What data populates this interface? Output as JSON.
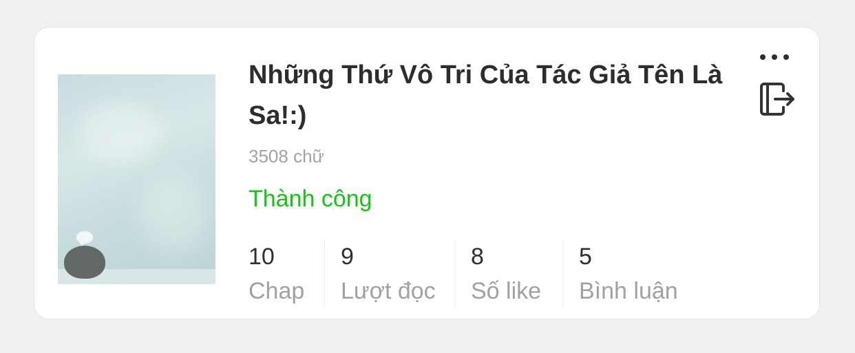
{
  "story": {
    "title": "Những Thứ Vô Tri Của Tác Giả Tên Là Sa!:)",
    "word_count": "3508 chữ",
    "status": "Thành công",
    "stats": [
      {
        "value": "10",
        "label": "Chap"
      },
      {
        "value": "9",
        "label": "Lượt đọc"
      },
      {
        "value": "8",
        "label": "Số like"
      },
      {
        "value": "5",
        "label": "Bình luận"
      }
    ]
  },
  "icons": {
    "more": "more-horizontal-icon",
    "exit": "exit-icon"
  },
  "colors": {
    "status": "#12c712",
    "title": "#2d2d2d",
    "muted": "#a1a1a1",
    "background": "#f0f0f1"
  }
}
